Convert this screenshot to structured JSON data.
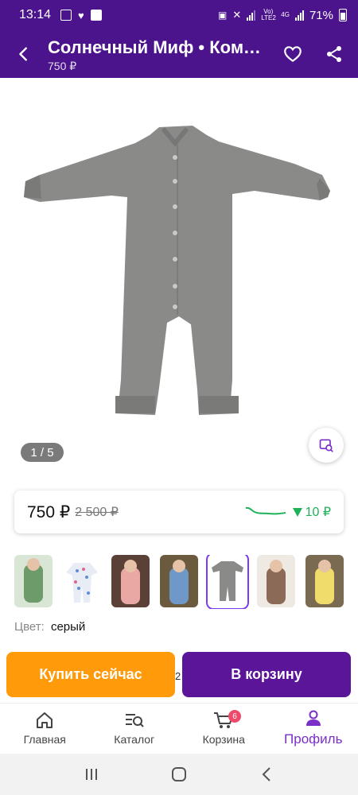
{
  "status_bar": {
    "time": "13:14",
    "battery": "71%",
    "network": "4G",
    "volte": "Vo) LTE2"
  },
  "app_bar": {
    "title": "Солнечный Миф • Комбинезон",
    "subtitle": "750 ₽",
    "back_icon": "arrow-left-icon",
    "favorite_icon": "heart-outline-icon",
    "share_icon": "share-icon"
  },
  "gallery": {
    "counter": "1 / 5",
    "find_similar_icon": "image-search-icon"
  },
  "price": {
    "current": "750 ₽",
    "old": "2 500 ₽",
    "drop": "10 ₽"
  },
  "color": {
    "label": "Цвет:",
    "value": "серый"
  },
  "swatches": [
    {
      "name": "green",
      "color": "#6e9b6a"
    },
    {
      "name": "print",
      "color": "#e8edf5"
    },
    {
      "name": "pink",
      "color": "#e9a8a4"
    },
    {
      "name": "blue",
      "color": "#6f97c7"
    },
    {
      "name": "gray",
      "color": "#8a8a88",
      "selected": true
    },
    {
      "name": "brown",
      "color": "#8b6b58"
    },
    {
      "name": "yellow",
      "color": "#f0dc6a"
    }
  ],
  "actions": {
    "buy_now": "Купить сейчас",
    "add_to_cart": "В корзину"
  },
  "peek": "2",
  "bottom_nav": {
    "items": [
      {
        "label": "Главная",
        "icon": "home-icon"
      },
      {
        "label": "Каталог",
        "icon": "catalog-search-icon"
      },
      {
        "label": "Корзина",
        "icon": "cart-icon",
        "badge": "6"
      },
      {
        "label": "Профиль",
        "icon": "profile-icon",
        "active": true
      }
    ]
  },
  "colors": {
    "brand": "#4c148c",
    "accent_orange": "#ff9a0a",
    "accent_purple": "#5b1598",
    "price_drop": "#1fb158"
  }
}
